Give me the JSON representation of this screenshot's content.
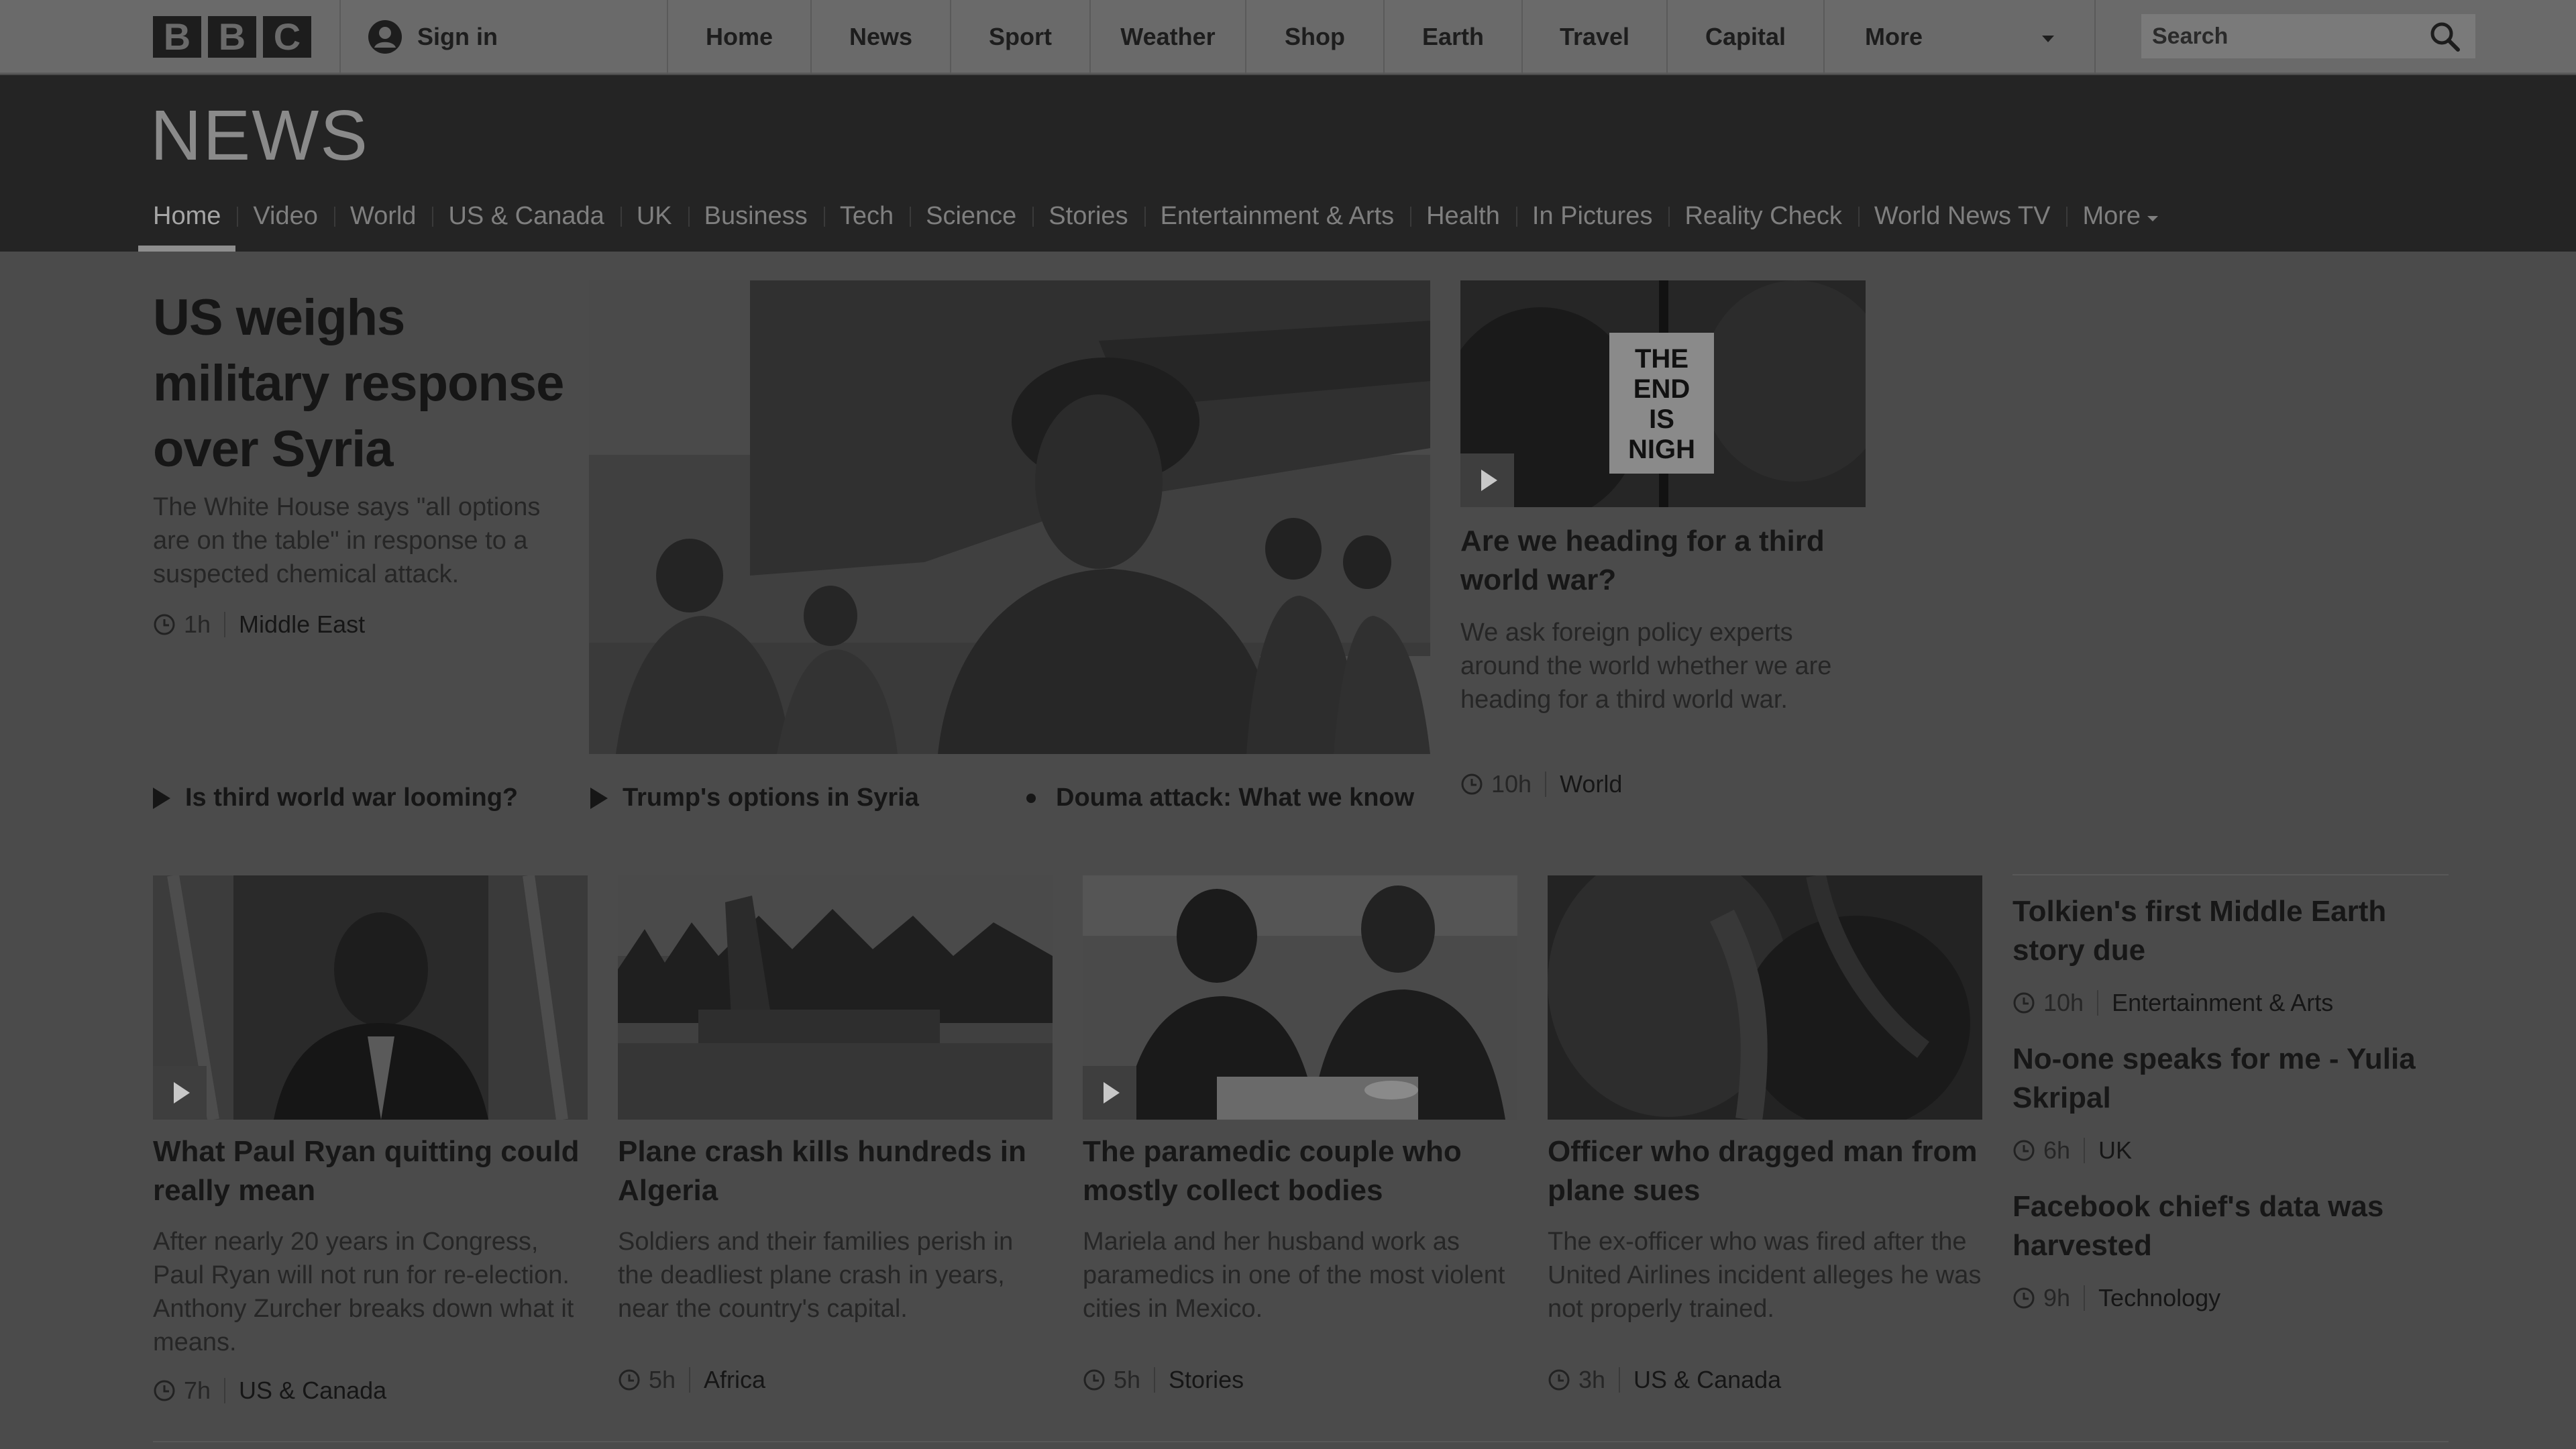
{
  "masthead": {
    "logo_letters": [
      "B",
      "B",
      "C"
    ],
    "sign_in": "Sign in",
    "nav": [
      "Home",
      "News",
      "Sport",
      "Weather",
      "Shop",
      "Earth",
      "Travel",
      "Capital"
    ],
    "more": "More",
    "search_placeholder": "Search"
  },
  "news_header": {
    "title": "NEWS",
    "nav": [
      "Home",
      "Video",
      "World",
      "US & Canada",
      "UK",
      "Business",
      "Tech",
      "Science",
      "Stories",
      "Entertainment & Arts",
      "Health",
      "In Pictures",
      "Reality Check",
      "World News TV"
    ],
    "more": "More",
    "active": "Home"
  },
  "lead": {
    "headline": "US weighs military response over Syria",
    "summary": "The White House says \"all options are on the table\" in response to a suspected chemical attack.",
    "age": "1h",
    "section": "Middle East",
    "related": [
      {
        "label": "Is third world war looming?",
        "icon": "play-icon"
      },
      {
        "label": "Trump's options in Syria",
        "icon": "play-icon"
      },
      {
        "label": "Douma attack: What we know",
        "icon": "bullet-dot"
      }
    ]
  },
  "secondary": {
    "sign_text": [
      "THE",
      "END",
      "IS",
      "NIGH"
    ],
    "title": "Are we heading for a third world war?",
    "summary": "We ask foreign policy experts around the world whether we are heading for a third world war.",
    "age": "10h",
    "section": "World"
  },
  "cards": [
    {
      "title": "What Paul Ryan quitting could really mean",
      "summary": "After nearly 20 years in Congress, Paul Ryan will not run for re-election. Anthony Zurcher breaks down what it means.",
      "age": "7h",
      "section": "US & Canada",
      "video": true
    },
    {
      "title": "Plane crash kills hundreds in Algeria",
      "summary": "Soldiers and their families perish in the deadliest plane crash in years, near the country's capital.",
      "age": "5h",
      "section": "Africa",
      "video": false
    },
    {
      "title": "The paramedic couple who mostly collect bodies",
      "summary": "Mariela and her husband work as paramedics in one of the most violent cities in Mexico.",
      "age": "5h",
      "section": "Stories",
      "video": true
    },
    {
      "title": "Officer who dragged man from plane sues",
      "summary": "The ex-officer who was fired after the United Airlines incident alleges he was not properly trained.",
      "age": "3h",
      "section": "US & Canada",
      "video": false
    }
  ],
  "side_list": [
    {
      "title": "Tolkien's first Middle Earth story due",
      "age": "10h",
      "section": "Entertainment & Arts"
    },
    {
      "title": "No-one speaks for me - Yulia Skripal",
      "age": "6h",
      "section": "UK"
    },
    {
      "title": "Facebook chief's data was harvested",
      "age": "9h",
      "section": "Technology"
    }
  ]
}
